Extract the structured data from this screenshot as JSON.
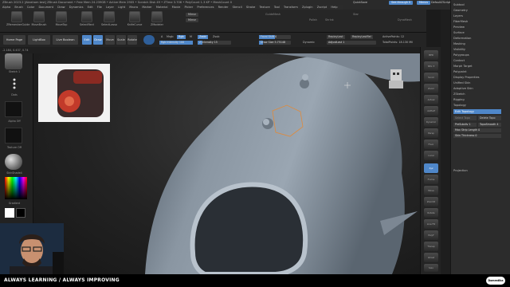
{
  "title_bar": {
    "text": "ZBrush 2023.2 [Abraham test]   ZBrush Document   • Free Mem 24.239GB • Active Mem 2905 • Scratch Disk 49 • ZTime 3.706 • PolyCount 1.3 KP • MeshCount 0"
  },
  "menu_bar": {
    "items": [
      "Alpha",
      "Brush",
      "Color",
      "Document",
      "Draw",
      "Dynamics",
      "Edit",
      "File",
      "Layer",
      "Light",
      "Macro",
      "Marker",
      "Material",
      "Movie",
      "Picker",
      "Preferences",
      "Render",
      "Stencil",
      "Stroke",
      "Texture",
      "Tool",
      "Transform",
      "Zplugin",
      "Zscript",
      "Help"
    ]
  },
  "top_right": {
    "quicksave": "QuickSave",
    "see_through": "See-through 0",
    "menus": "Menus",
    "script": "DefaultZScript"
  },
  "shelf": {
    "buttons": [
      "ZRemesherGuide",
      "MoveBrush",
      "MoveTop",
      "SelectRect",
      "SelectLasso",
      "KnifeCurve",
      "ZModeler"
    ],
    "mirror_label": "Mirror",
    "mirror2_label": "Mirror",
    "gizmo_label": "GuideMesh",
    "polish": "Polish",
    "shrink": "Shrink",
    "dynamesh": "DynaMesh",
    "gizmo_right": "Gizmo3D",
    "star_label": "Star",
    "bake_label": "Bake"
  },
  "toolbar": {
    "home_page": "Home Page",
    "lightbox": "LightBox",
    "live_boolean": "Live Boolean",
    "edit": "Edit",
    "draw": "Draw",
    "move": "Move",
    "scale": "Scale",
    "rotate": "Rotate",
    "a_label": "A",
    "mrgb": "Mrgb",
    "rgb": "Rgb",
    "m_label": "M",
    "zadd": "Zadd",
    "zsub": "Zsub",
    "rgb_intensity": "Rgb Intensity 100",
    "z_intensity": "Z Intensity 15",
    "focal_shift": "Focal Shift 0",
    "draw_size": "Draw Size 5.75148",
    "dynamic": "Dynamic",
    "replay_last": "ReplayLast",
    "replay_last_rel": "ReplayLastRel",
    "adjust_last": "AdjustLast 1",
    "active_points": "ActivePoints: 12",
    "total_points": "TotalPoints: 18.130 Mil",
    "rgb_intensity_pct": 100,
    "z_intensity_pct": 15,
    "focal_pct": 50,
    "draw_size_pct": 12
  },
  "coord": {
    "text": "-2.184, 0.437, 0.74"
  },
  "left_tray": {
    "brush_label": "Sketch 1",
    "stroke_label": "Dots",
    "alpha_label": "Alpha Off",
    "texture_label": "Texture Off",
    "material_label": "SkinShade4",
    "gradient_label": "Gradient",
    "switch_label": "SwitchColor"
  },
  "right_shelf": {
    "buttons": [
      "BPR",
      "SPix 3",
      "Scroll",
      "Zoom",
      "Actual",
      "AAHalf",
      "Dynamic",
      "Persp",
      "Floor",
      "Local",
      "Frame",
      "Move",
      "ZoomD",
      "Rotate",
      "Line Fill",
      "PolyF",
      "Transp",
      "Ghost",
      "Solo",
      "Xpose"
    ],
    "xyz_label": "Xyz"
  },
  "palette": {
    "items": [
      "Subtool",
      "Geometry",
      "Layers",
      "FiberMesh",
      "Preview",
      "Surface",
      "Deformation",
      "Masking",
      "Visibility",
      "Polygroups",
      "Contact",
      "Morph Target",
      "Polypaint",
      "Display Properties",
      "Unified Skin",
      "Adaptive Skin",
      "ZSketch",
      "Rigging",
      "Topology"
    ],
    "edit_topology": "Edit Topology",
    "select_topo": "Select Topo",
    "delete_topo": "Delete Topo",
    "pre_subdiv": "PreSubdiv 1",
    "topo_smooth": "TopoSmooth 4",
    "max_strip_length": "Max Strip Length 0",
    "skin_thickness": "Skin Thickness 0",
    "projection": "Projection"
  },
  "footer": {
    "tagline": "ALWAYS LEARNING  /  ALWAYS IMPROVING",
    "logo": "Domestika"
  },
  "colors": {
    "accent_blue": "#4f87c9",
    "orange_highlight": "#e08a3a",
    "bg": "#1b1b1b"
  }
}
